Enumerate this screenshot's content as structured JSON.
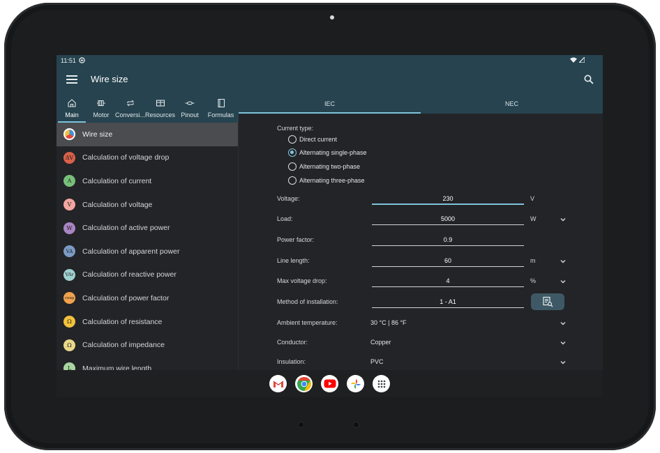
{
  "status_bar": {
    "time": "11:51"
  },
  "app_bar": {
    "title": "Wire size"
  },
  "categories": [
    {
      "label": "Main",
      "icon": "home-icon"
    },
    {
      "label": "Motor",
      "icon": "motor-icon"
    },
    {
      "label": "Conversi...",
      "icon": "conversion-icon"
    },
    {
      "label": "Resources",
      "icon": "resources-icon"
    },
    {
      "label": "Pinout",
      "icon": "pinout-icon"
    },
    {
      "label": "Formulas",
      "icon": "formulas-icon"
    }
  ],
  "standard_tabs": [
    "IEC",
    "NEC"
  ],
  "sidebar": {
    "items": [
      {
        "label": "Wire size",
        "symbol": "",
        "color": "#ffffff"
      },
      {
        "label": "Calculation of voltage drop",
        "symbol": "ΔV",
        "color": "#d9604a"
      },
      {
        "label": "Calculation of current",
        "symbol": "A",
        "color": "#78c07a"
      },
      {
        "label": "Calculation of voltage",
        "symbol": "V",
        "color": "#f3a6a0"
      },
      {
        "label": "Calculation of active power",
        "symbol": "W",
        "color": "#a985c4"
      },
      {
        "label": "Calculation of apparent power",
        "symbol": "VA",
        "color": "#7b9bc4"
      },
      {
        "label": "Calculation of reactive power",
        "symbol": "VAr",
        "color": "#9fd0d0"
      },
      {
        "label": "Calculation of power factor",
        "symbol": "cosφ",
        "color": "#f0a24e"
      },
      {
        "label": "Calculation of resistance",
        "symbol": "Ω",
        "color": "#f2c23c"
      },
      {
        "label": "Calculation of impedance",
        "symbol": "Ω",
        "color": "#e8d88a"
      },
      {
        "label": "Maximum wire length",
        "symbol": "L",
        "color": "#a8d6a0"
      }
    ]
  },
  "form": {
    "current_type_label": "Current type:",
    "current_types": [
      "Direct current",
      "Alternating single-phase",
      "Alternating two-phase",
      "Alternating three-phase"
    ],
    "selected_current_type": 1,
    "rows": {
      "voltage": {
        "label": "Voltage:",
        "value": "230",
        "unit": "V"
      },
      "load": {
        "label": "Load:",
        "value": "5000",
        "unit": "W"
      },
      "power_factor": {
        "label": "Power factor:",
        "value": "0.9"
      },
      "line_length": {
        "label": "Line length:",
        "value": "60",
        "unit": "m"
      },
      "max_voltage_drop": {
        "label": "Max voltage drop:",
        "value": "4",
        "unit": "%"
      },
      "method": {
        "label": "Method of installation:",
        "value": "1  -  A1"
      },
      "ambient": {
        "label": "Ambient temperature:",
        "value": "30 °C | 86 °F"
      },
      "conductor": {
        "label": "Conductor:",
        "value": "Copper"
      },
      "insulation": {
        "label": "Insulation:",
        "value": "PVC"
      }
    }
  },
  "dock": [
    "Gmail",
    "Chrome",
    "YouTube",
    "Photos",
    "Apps"
  ],
  "colors": {
    "app_bar": "#26434f",
    "accent": "#7ec3dc",
    "background": "#232427"
  }
}
